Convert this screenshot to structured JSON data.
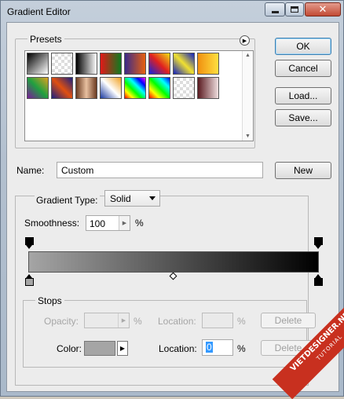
{
  "window": {
    "title": "Gradient Editor"
  },
  "presets": {
    "label": "Presets"
  },
  "buttons": {
    "ok": "OK",
    "cancel": "Cancel",
    "load": "Load...",
    "save": "Save...",
    "new": "New",
    "delete": "Delete"
  },
  "name": {
    "label": "Name:",
    "value": "Custom"
  },
  "gradient_type": {
    "label": "Gradient Type:",
    "value": "Solid"
  },
  "smoothness": {
    "label": "Smoothness:",
    "value": "100",
    "unit": "%"
  },
  "gradient": {
    "start_color": "#a5a5a5",
    "end_color": "#000000",
    "midpoint_percent": 50
  },
  "stops": {
    "label": "Stops",
    "opacity_label": "Opacity:",
    "opacity_unit": "%",
    "opacity_location_label": "Location:",
    "opacity_location_unit": "%",
    "color_label": "Color:",
    "color_value": "#a5a5a5",
    "color_location_label": "Location:",
    "color_location_value": "0",
    "color_location_unit": "%"
  },
  "watermark": {
    "text": "VIETDESIGNER.NET",
    "sub": "TUTORIAL"
  }
}
